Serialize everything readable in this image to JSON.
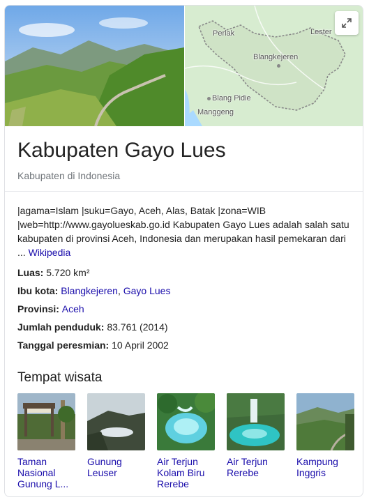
{
  "map": {
    "labels": {
      "perlak": "Perlak",
      "lester": "Lester",
      "blangkejeren": "Blangkejeren",
      "blang_pidie": "Blang Pidie",
      "manggeng": "Manggeng"
    },
    "expand_icon": "expand-icon"
  },
  "entity": {
    "title": "Kabupaten Gayo Lues",
    "subtitle": "Kabupaten di Indonesia"
  },
  "description": {
    "text": "|agama=Islam |suku=Gayo, Aceh, Alas, Batak |zona=WIB |web=http://www.gayolueskab.go.id Kabupaten Gayo Lues adalah salah satu kabupaten di provinsi Aceh, Indonesia dan merupakan hasil pemekaran dari ... ",
    "source_link": "Wikipedia"
  },
  "facts": {
    "luas": {
      "label": "Luas:",
      "value": " 5.720 km²"
    },
    "ibu_kota": {
      "label": "Ibu kota:",
      "link1": "Blangkejeren",
      "sep": ", ",
      "link2": "Gayo Lues"
    },
    "provinsi": {
      "label": "Provinsi:",
      "link": "Aceh"
    },
    "penduduk": {
      "label": "Jumlah penduduk:",
      "value": " 83.761 (2014)"
    },
    "peresmian": {
      "label": "Tanggal peresmian:",
      "value": " 10 April 2002"
    }
  },
  "attractions": {
    "title": "Tempat wisata",
    "items": [
      {
        "label": "Taman Nasional Gunung L..."
      },
      {
        "label": "Gunung Leuser"
      },
      {
        "label": "Air Terjun Kolam Biru Rerebe"
      },
      {
        "label": "Air Terjun Rerebe"
      },
      {
        "label": "Kampung Inggris"
      }
    ]
  },
  "colors": {
    "link": "#1a0dab",
    "title": "#222222",
    "secondary": "#70757a",
    "map_land": "#d7ecd0",
    "map_sea": "#aadaff"
  }
}
